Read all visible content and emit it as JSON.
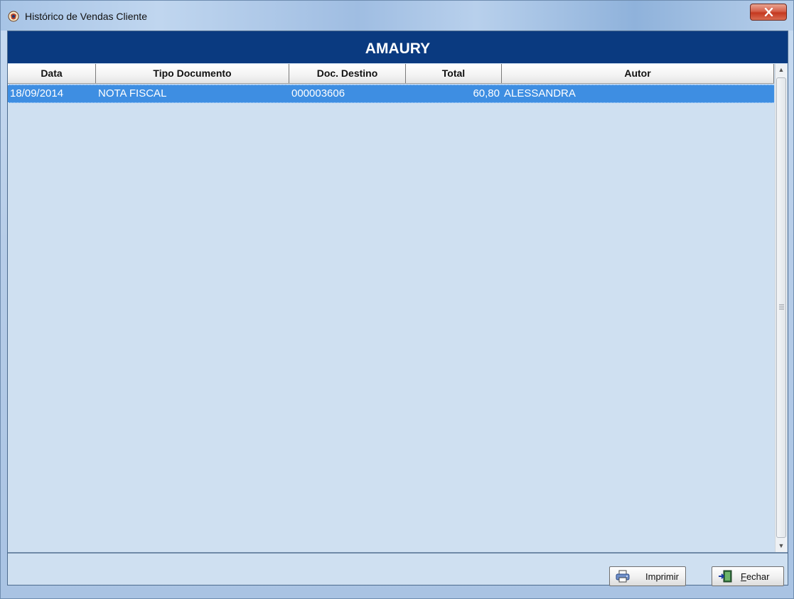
{
  "window": {
    "title": "Histórico de Vendas Cliente"
  },
  "banner": {
    "customer_name": "AMAURY"
  },
  "grid": {
    "columns": [
      "Data",
      "Tipo Documento",
      "Doc. Destino",
      "Total",
      "Autor"
    ],
    "rows": [
      {
        "data": "18/09/2014",
        "tipo_documento": "NOTA FISCAL",
        "doc_destino": "000003606",
        "total": "60,80",
        "autor": "ALESSANDRA",
        "selected": true
      }
    ]
  },
  "buttons": {
    "print_label": "Imprimir",
    "close_label": "Fechar",
    "close_access_key": "F",
    "close_label_rest": "echar"
  },
  "icons": {
    "app": "app-logo-icon",
    "close": "close-icon",
    "print": "printer-icon",
    "exit": "exit-door-icon"
  },
  "colors": {
    "banner_bg": "#0a3a80",
    "selected_row": "#3e8ee2",
    "grid_bg": "#cfe0f1"
  }
}
